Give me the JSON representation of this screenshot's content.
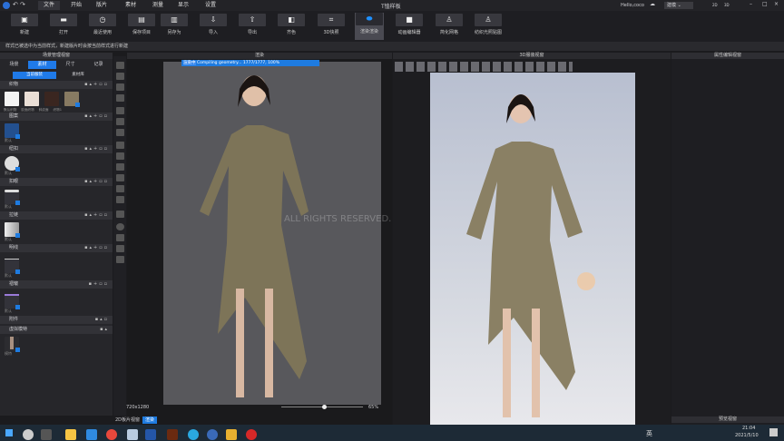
{
  "titlebar": {
    "app_title": "T恤样板",
    "user": "Hello,coco",
    "mode": "建模",
    "view_buttons": [
      "2D",
      "3D"
    ],
    "menus": [
      "文件",
      "开始",
      "版片",
      "素材",
      "测量",
      "显示",
      "设置"
    ]
  },
  "toolbar": {
    "buttons": [
      {
        "label": "新建",
        "icon": "new-file-icon"
      },
      {
        "label": "打开",
        "icon": "folder-icon"
      },
      {
        "label": "最近使用",
        "icon": "clock-icon"
      },
      {
        "label": "保存项目",
        "icon": "save-icon"
      },
      {
        "label": "另存为",
        "icon": "save-as-icon"
      },
      {
        "label": "导入",
        "icon": "import-icon"
      },
      {
        "label": "导出",
        "icon": "export-icon"
      },
      {
        "label": "齐色",
        "icon": "colorway-icon"
      },
      {
        "label": "3D快照",
        "icon": "snapshot-icon"
      },
      {
        "label": "渲染渲染",
        "icon": "render-icon"
      },
      {
        "label": "动画编辑器",
        "icon": "video-icon"
      },
      {
        "label": "简化网格",
        "icon": "mesh-icon"
      },
      {
        "label": "纺织光照贴图",
        "icon": "texture-icon"
      }
    ]
  },
  "notice": "样式已被选中为当前样式，新建版片时会按当前样式进行新建",
  "left_panel": {
    "title": "场景管理视窗",
    "tabs": [
      "场景",
      "素材",
      "尺寸",
      "记录"
    ],
    "subtabs": [
      "当前服装",
      "素材库"
    ],
    "sections": [
      {
        "label": "织物"
      },
      {
        "label": "图案"
      },
      {
        "label": "纽扣"
      },
      {
        "label": "扣眼"
      },
      {
        "label": "拉链"
      },
      {
        "label": "明线"
      },
      {
        "label": "褶皱"
      },
      {
        "label": "附件"
      },
      {
        "label": "虚拟模特"
      }
    ],
    "fabrics": [
      {
        "label": "默认织物",
        "color": "#f4f4f4"
      },
      {
        "label": "胶面织物",
        "color": "#eadfd6"
      },
      {
        "label": "斜纹面",
        "color": "#3a2620"
      },
      {
        "label": "织物1",
        "color": "#877a62"
      }
    ],
    "default_label": "默认",
    "avatar_label": "模特"
  },
  "render_view": {
    "title": "渲染",
    "progress_text": "Compiling geometry...  1777/1777, 100%",
    "progress_prefix": "渲染中",
    "progress": 1.0,
    "resolution": "720x1280",
    "zoom": "65%",
    "zoom_value": 0.55
  },
  "view3d": {
    "title": "3D服装视窗",
    "watermark": "ALL RIGHTS RESERVED."
  },
  "right_panel": {
    "title": "属性编辑视窗",
    "preview_title": "预览视窗"
  },
  "bottom_tabs": [
    "2D板片视窗",
    "渲染"
  ],
  "taskbar": {
    "time": "21:04",
    "date": "2021/5/10",
    "ime": "英"
  }
}
